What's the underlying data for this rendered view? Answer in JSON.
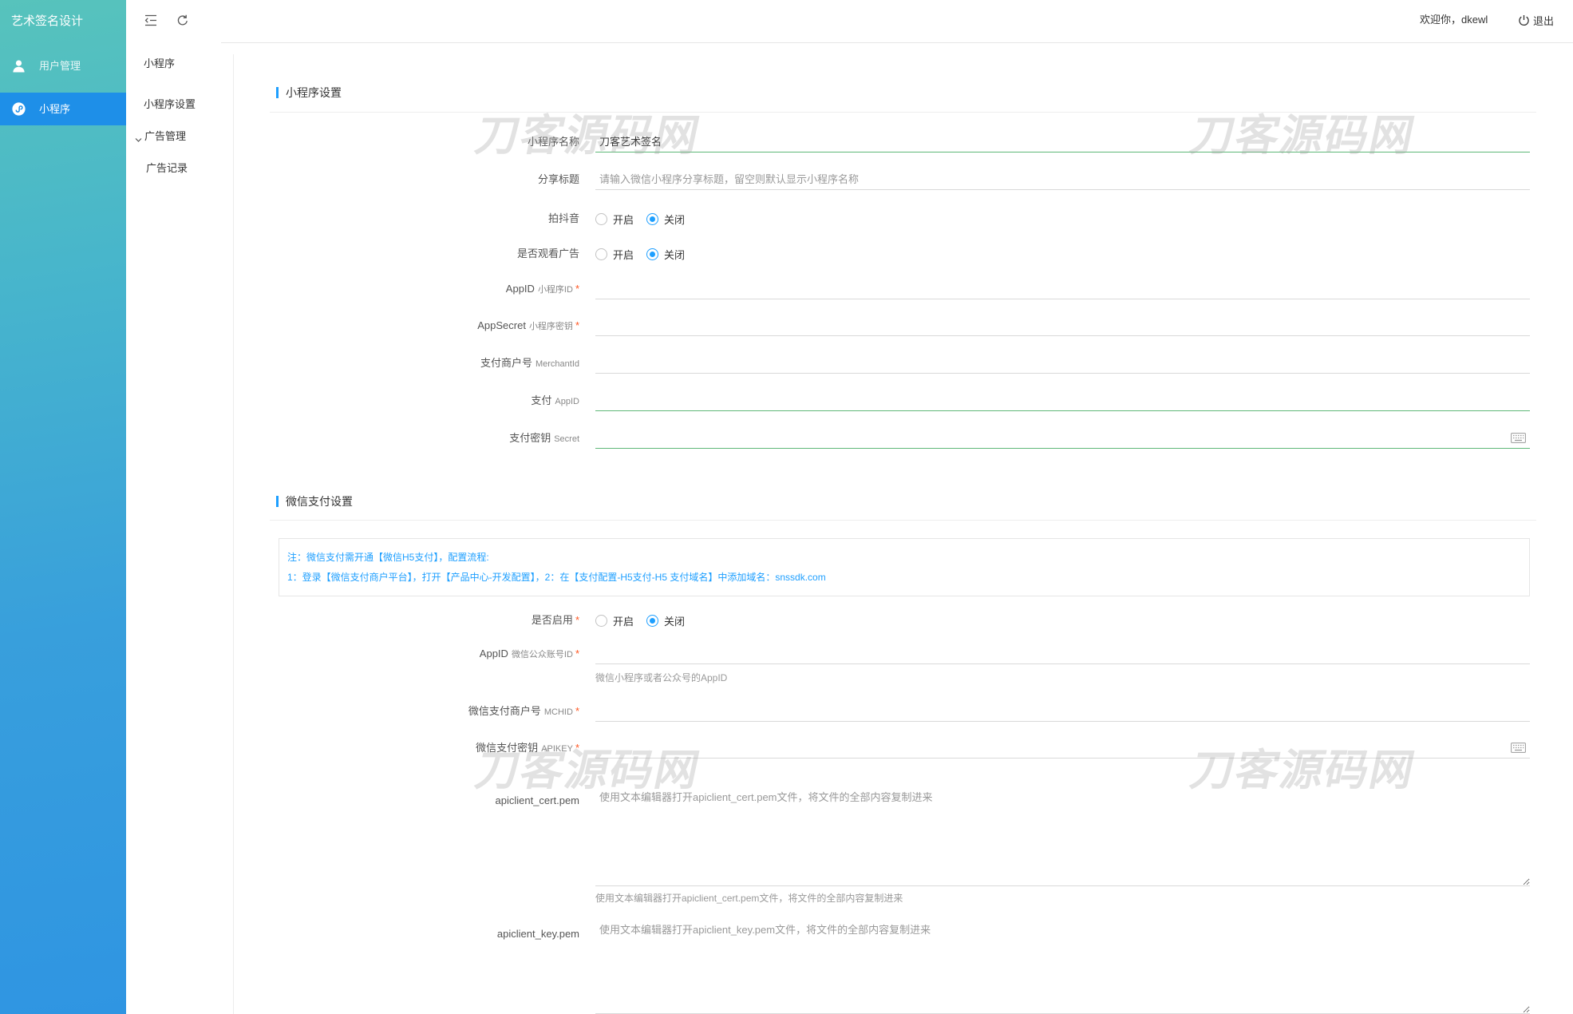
{
  "app": {
    "title": "艺术签名设计"
  },
  "theme": {
    "accent": "#1e9fff",
    "success": "#5fb878",
    "danger": "#ff5722",
    "sidebar_active": "#1e8fe8"
  },
  "sidebar": {
    "items": [
      {
        "label": "用户管理",
        "icon": "user-icon"
      },
      {
        "label": "小程序",
        "icon": "mini-program-icon",
        "active": true
      }
    ]
  },
  "subnav": {
    "heading": "小程序",
    "items": [
      {
        "label": "小程序设置"
      },
      {
        "label": "广告管理",
        "icon": "chevron-down-icon",
        "expanded": true
      },
      {
        "label": "广告记录"
      }
    ]
  },
  "header": {
    "welcome": "欢迎你，dkewl",
    "logout": "退出",
    "icons": [
      "menu-fold-icon",
      "refresh-icon",
      "power-icon"
    ]
  },
  "watermark": "刀客源码网",
  "form": {
    "required_mark": "*"
  },
  "miniprogram": {
    "title": "小程序设置",
    "name": {
      "label": "小程序名称",
      "value": "刀客艺术签名"
    },
    "share_title": {
      "label": "分享标题",
      "placeholder": "请输入微信小程序分享标题，留空则默认显示小程序名称"
    },
    "douyin": {
      "label": "拍抖音",
      "options": [
        "开启",
        "关闭"
      ],
      "selected": "关闭"
    },
    "watch_ad": {
      "label": "是否观看广告",
      "options": [
        "开启",
        "关闭"
      ],
      "selected": "关闭"
    },
    "appid": {
      "label": "AppID",
      "sub": "小程序ID",
      "required": true
    },
    "appsecret": {
      "label": "AppSecret",
      "sub": "小程序密钥",
      "required": true
    },
    "merchant_id": {
      "label": "支付商户号",
      "sub": "MerchantId"
    },
    "pay_appid": {
      "label": "支付",
      "sub": "AppID"
    },
    "pay_secret": {
      "label": "支付密钥",
      "sub": "Secret",
      "icon": "keyboard-icon"
    }
  },
  "wechat_pay": {
    "title": "微信支付设置",
    "notice": [
      "注：微信支付需开通【微信H5支付】，配置流程:",
      "1：登录【微信支付商户平台】，打开【产品中心-开发配置】，2：在【支付配置-H5支付-H5 支付域名】中添加域名：snssdk.com"
    ],
    "enable": {
      "label": "是否启用",
      "required": true,
      "options": [
        "开启",
        "关闭"
      ],
      "selected": "关闭"
    },
    "appid": {
      "label": "AppID",
      "sub": "微信公众账号ID",
      "required": true,
      "help": "微信小程序或者公众号的AppID"
    },
    "mchid": {
      "label": "微信支付商户号",
      "sub": "MCHID",
      "required": true
    },
    "apikey": {
      "label": "微信支付密钥",
      "sub": "APIKEY",
      "required": true,
      "icon": "keyboard-icon"
    },
    "cert": {
      "label": "apiclient_cert.pem",
      "placeholder": "使用文本编辑器打开apiclient_cert.pem文件，将文件的全部内容复制进来",
      "help": "使用文本编辑器打开apiclient_cert.pem文件，将文件的全部内容复制进来"
    },
    "key": {
      "label": "apiclient_key.pem",
      "placeholder": "使用文本编辑器打开apiclient_key.pem文件，将文件的全部内容复制进来"
    }
  }
}
